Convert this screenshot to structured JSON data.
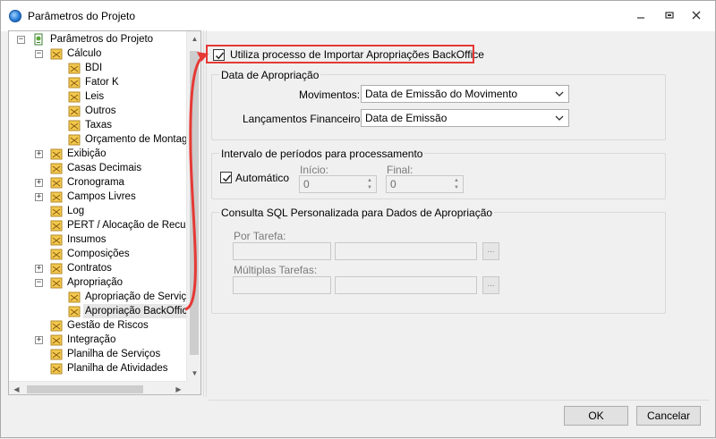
{
  "window": {
    "title": "Parâmetros do Projeto"
  },
  "tree": {
    "items": [
      {
        "label": "Parâmetros do Projeto",
        "level": 0,
        "expander": "−",
        "icon": "gear-sheet-icon"
      },
      {
        "label": "Cálculo",
        "level": 1,
        "expander": "−",
        "icon": "folder-icon"
      },
      {
        "label": "BDI",
        "level": 2,
        "icon": "folder-icon"
      },
      {
        "label": "Fator K",
        "level": 2,
        "icon": "folder-icon"
      },
      {
        "label": "Leis",
        "level": 2,
        "icon": "folder-icon"
      },
      {
        "label": "Outros",
        "level": 2,
        "icon": "folder-icon"
      },
      {
        "label": "Taxas",
        "level": 2,
        "icon": "folder-icon"
      },
      {
        "label": "Orçamento de Montagem",
        "level": 2,
        "icon": "folder-icon"
      },
      {
        "label": "Exibição",
        "level": 1,
        "expander": "+",
        "icon": "folder-icon"
      },
      {
        "label": "Casas Decimais",
        "level": 1,
        "icon": "folder-icon"
      },
      {
        "label": "Cronograma",
        "level": 1,
        "expander": "+",
        "icon": "folder-icon"
      },
      {
        "label": "Campos Livres",
        "level": 1,
        "expander": "+",
        "icon": "folder-icon"
      },
      {
        "label": "Log",
        "level": 1,
        "icon": "folder-icon"
      },
      {
        "label": "PERT / Alocação de Recursos",
        "level": 1,
        "icon": "folder-icon"
      },
      {
        "label": "Insumos",
        "level": 1,
        "icon": "folder-icon"
      },
      {
        "label": "Composições",
        "level": 1,
        "icon": "folder-icon"
      },
      {
        "label": "Contratos",
        "level": 1,
        "expander": "+",
        "icon": "folder-icon"
      },
      {
        "label": "Apropriação",
        "level": 1,
        "expander": "−",
        "icon": "folder-icon"
      },
      {
        "label": "Apropriação de Serviços",
        "level": 2,
        "icon": "folder-icon"
      },
      {
        "label": "Apropriação BackOffice",
        "level": 2,
        "icon": "folder-icon",
        "selected": true
      },
      {
        "label": "Gestão de Riscos",
        "level": 1,
        "icon": "folder-icon"
      },
      {
        "label": "Integração",
        "level": 1,
        "expander": "+",
        "icon": "folder-icon"
      },
      {
        "label": "Planilha de Serviços",
        "level": 1,
        "icon": "folder-icon"
      },
      {
        "label": "Planilha de Atividades",
        "level": 1,
        "icon": "folder-icon"
      }
    ]
  },
  "backoffice": {
    "use_import_label": "Utiliza processo de Importar Apropriações BackOffice",
    "use_import_checked": true
  },
  "apropriacao_group": {
    "title": "Data de Apropriação",
    "movimentos_label": "Movimentos:",
    "movimentos_value": "Data de Emissão do Movimento",
    "lancamentos_label": "Lançamentos Financeiros:",
    "lancamentos_value": "Data de Emissão"
  },
  "intervalo_group": {
    "title": "Intervalo de períodos para processamento",
    "automatico_label": "Automático",
    "automatico_checked": true,
    "inicio_label": "Início:",
    "inicio_value": "0",
    "final_label": "Final:",
    "final_value": "0"
  },
  "sql_group": {
    "title": "Consulta SQL Personalizada para Dados de Apropriação",
    "por_tarefa_label": "Por Tarefa:",
    "multiplas_label": "Múltiplas Tarefas:",
    "browse_label": "..."
  },
  "footer": {
    "ok_label": "OK",
    "cancel_label": "Cancelar"
  },
  "colors": {
    "highlight": "#e53935",
    "folder": "#f2c94c"
  }
}
